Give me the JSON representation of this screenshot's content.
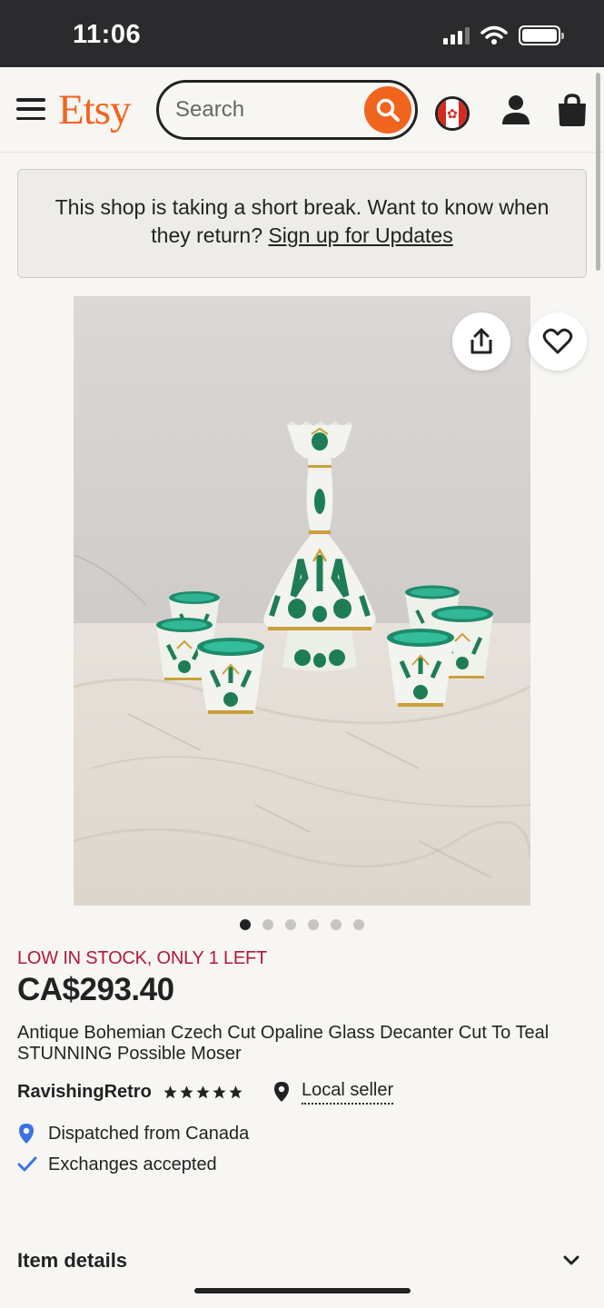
{
  "status_bar": {
    "time": "11:06"
  },
  "header": {
    "logo": "Etsy",
    "search": {
      "placeholder": "Search",
      "value": ""
    },
    "icons": [
      "menu-icon",
      "search-icon",
      "canada-flag-icon",
      "user-icon",
      "shopping-bag-icon"
    ]
  },
  "notice": {
    "text": "This shop is taking a short break. Want to know when they return? ",
    "link": "Sign up for Updates"
  },
  "gallery": {
    "slide_count": 6,
    "active_slide": 1,
    "icons": [
      "share-icon",
      "heart-icon"
    ]
  },
  "listing": {
    "stock": "LOW IN STOCK, ONLY 1 LEFT",
    "price": "CA$293.40",
    "title": "Antique Bohemian Czech Cut Opaline Glass Decanter Cut To Teal STUNNING Possible Moser",
    "seller": "RavishingRetro",
    "rating": 5,
    "local_seller": "Local seller",
    "dispatched": "Dispatched from Canada",
    "exchanges": "Exchanges accepted"
  },
  "item_details": {
    "label": "Item details"
  },
  "colors": {
    "brand": "#f1641e",
    "stock_alert": "#b3183d",
    "location": "#3b72e0",
    "background": "#f7f6f3"
  }
}
